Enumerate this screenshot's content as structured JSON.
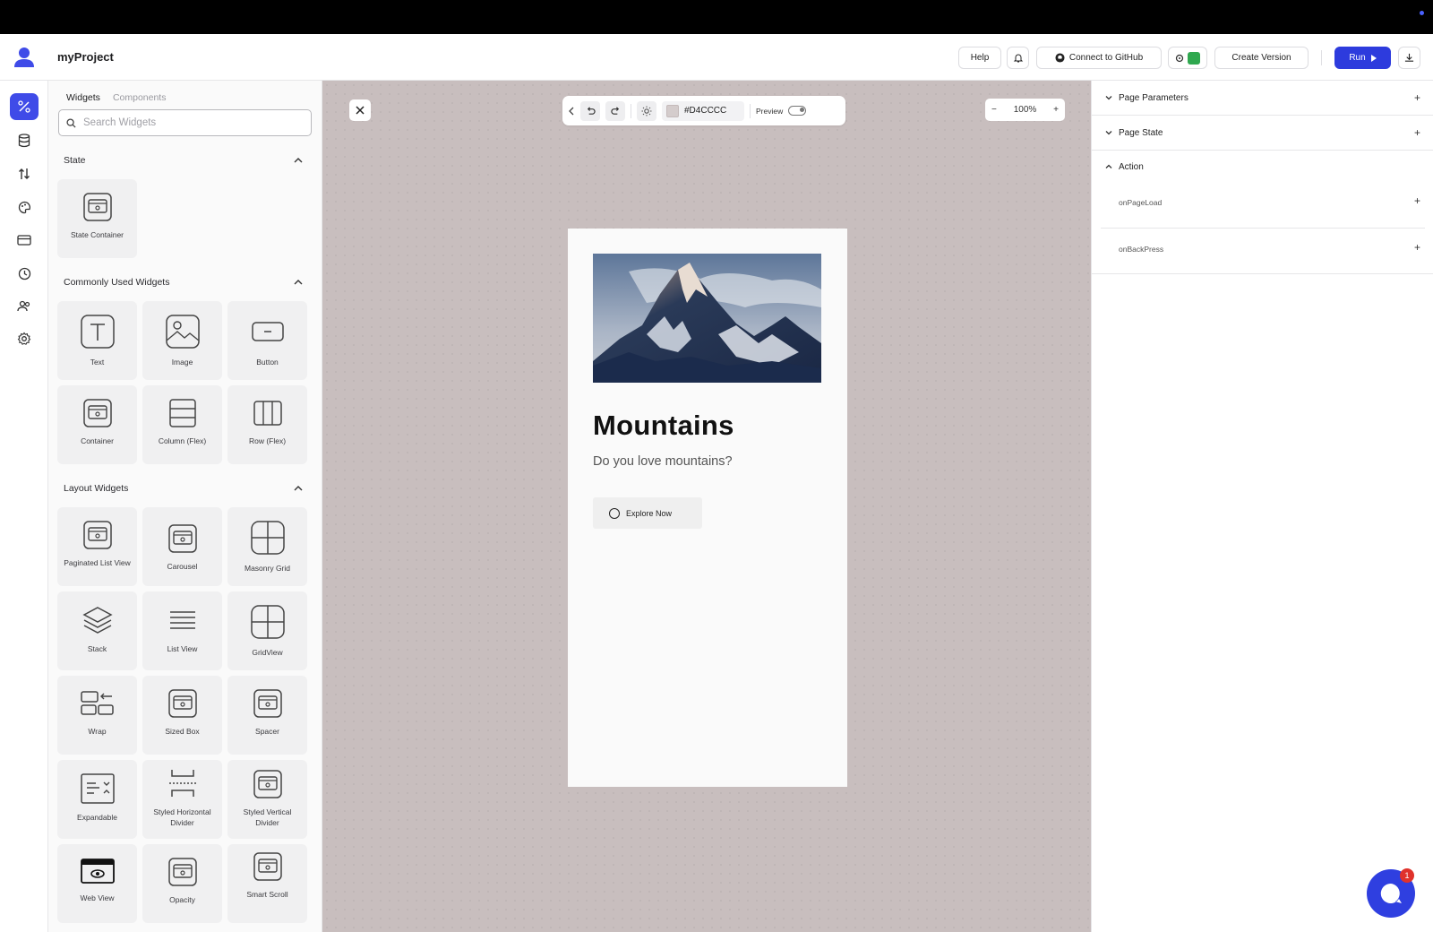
{
  "app": {
    "project_name": "myProject"
  },
  "header": {
    "help_label": "Help",
    "github_label": "Connect to GitHub",
    "create_version_label": "Create Version",
    "run_label": "Run",
    "icons": [
      "bell-icon",
      "github-icon",
      "settings-icon",
      "download-icon"
    ]
  },
  "widgets_panel": {
    "tabs": [
      {
        "label": "Widgets",
        "active": true
      },
      {
        "label": "Components",
        "active": false
      }
    ],
    "search_placeholder": "Search Widgets",
    "sections": [
      {
        "title": "State",
        "items": [
          "State Container"
        ]
      },
      {
        "title": "Commonly Used Widgets",
        "items": [
          "Text",
          "Image",
          "Button",
          "Container",
          "Column (Flex)",
          "Row (Flex)"
        ]
      },
      {
        "title": "Layout Widgets",
        "items": [
          "Paginated List View",
          "Carousel",
          "Masonry Grid",
          "Stack",
          "List View",
          "GridView",
          "Wrap",
          "Sized Box",
          "Spacer",
          "Expandable",
          "Styled Horizontal Divider",
          "Styled Vertical Divider",
          "Web View",
          "Opacity",
          "Smart Scroll"
        ]
      }
    ]
  },
  "canvas_toolbar": {
    "background_color": "#D4CCCC",
    "preview_label": "Preview",
    "zoom": "100%"
  },
  "phone": {
    "title": "Mountains",
    "subtitle": "Do you love mountains?",
    "button_label": "Explore Now"
  },
  "right_panel": {
    "page_parameters": "Page Parameters",
    "page_state": "Page State",
    "action": "Action",
    "on_page_load": "onPageLoad",
    "on_back_press": "onBackPress"
  },
  "chat": {
    "badge": "1"
  },
  "colors": {
    "accent": "#2D3BDD",
    "canvas_bg": "#D4CCCC"
  }
}
